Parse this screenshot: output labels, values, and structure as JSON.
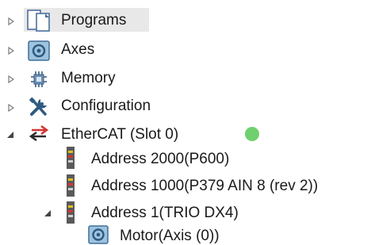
{
  "tree": {
    "programs": {
      "label": "Programs",
      "icon": "programs-document-icon"
    },
    "axes": {
      "label": "Axes",
      "icon": "axes-icon"
    },
    "memory": {
      "label": "Memory",
      "icon": "memory-icon"
    },
    "configuration": {
      "label": "Configuration",
      "icon": "tools-icon"
    },
    "ethercat": {
      "label": "EtherCAT (Slot 0)",
      "icon": "ethercat-arrows-icon",
      "status_color": "#6fd06f",
      "children": [
        {
          "label": "Address 2000(P600)",
          "icon": "device-icon"
        },
        {
          "label": "Address 1000(P379 AIN 8 (rev 2))",
          "icon": "device-icon"
        },
        {
          "label": "Address 1(TRIO DX4)",
          "icon": "device-icon",
          "children": [
            {
              "label": "Motor(Axis (0))",
              "icon": "axis-icon"
            }
          ]
        }
      ]
    }
  }
}
